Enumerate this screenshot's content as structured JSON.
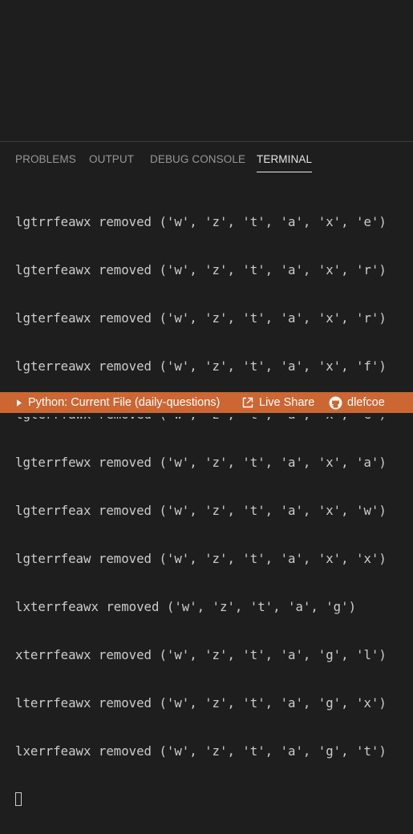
{
  "panel": {
    "tabs": [
      {
        "label": "PROBLEMS",
        "active": false
      },
      {
        "label": "OUTPUT",
        "active": false
      },
      {
        "label": "DEBUG CONSOLE",
        "active": false
      },
      {
        "label": "TERMINAL",
        "active": true
      }
    ]
  },
  "terminal": {
    "lines": [
      "lgtrrfeawx removed ('w', 'z', 't', 'a', 'x', 'e')",
      "lgterfeawx removed ('w', 'z', 't', 'a', 'x', 'r')",
      "lgterfeawx removed ('w', 'z', 't', 'a', 'x', 'r')",
      "lgterreawx removed ('w', 'z', 't', 'a', 'x', 'f')",
      "lgterrfawx removed ('w', 'z', 't', 'a', 'x', 'e')",
      "lgterrfewx removed ('w', 'z', 't', 'a', 'x', 'a')",
      "lgterrfeax removed ('w', 'z', 't', 'a', 'x', 'w')",
      "lgterrfeaw removed ('w', 'z', 't', 'a', 'x', 'x')",
      "lxterrfeawx removed ('w', 'z', 't', 'a', 'g')",
      "xterrfeawx removed ('w', 'z', 't', 'a', 'g', 'l')",
      "lterrfeawx removed ('w', 'z', 't', 'a', 'g', 'x')",
      "lxerrfeawx removed ('w', 'z', 't', 'a', 'g', 't')"
    ]
  },
  "statusbar": {
    "color": "#cc6633",
    "python_label": "Python: Current File (daily-questions)",
    "liveshare_label": "Live Share",
    "user_label": "dlefcoe"
  }
}
